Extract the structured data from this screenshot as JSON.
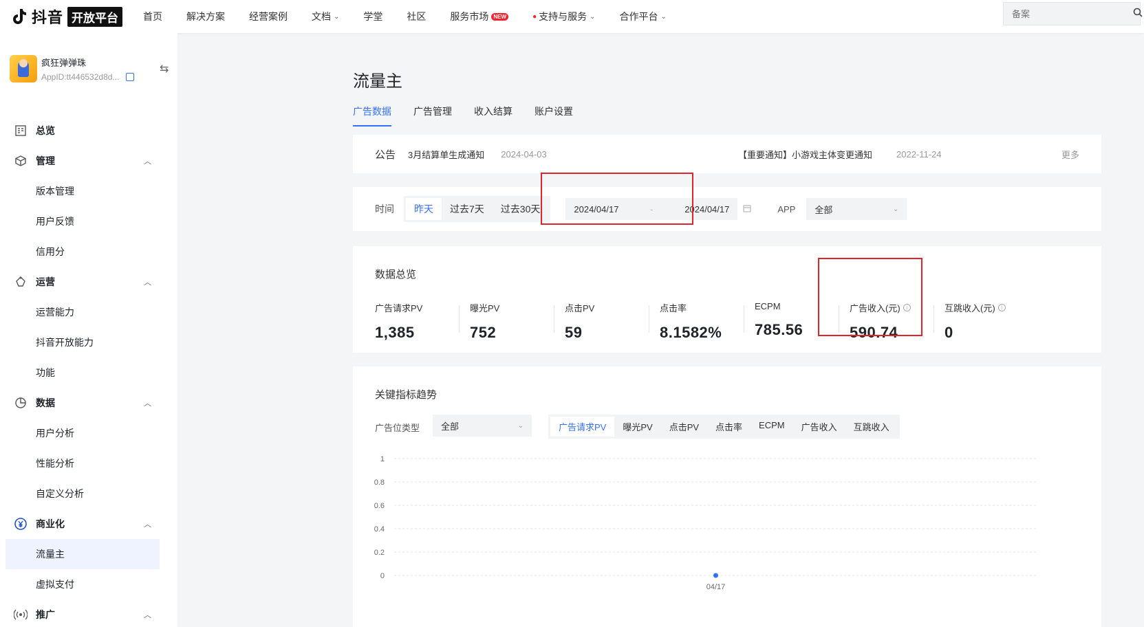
{
  "topnav": {
    "brand": "抖音",
    "badge": "开放平台",
    "links": [
      {
        "label": "首页",
        "dropdown": false
      },
      {
        "label": "解决方案",
        "dropdown": false
      },
      {
        "label": "经营案例",
        "dropdown": false
      },
      {
        "label": "文档",
        "dropdown": true
      },
      {
        "label": "学堂",
        "dropdown": false
      },
      {
        "label": "社区",
        "dropdown": false
      },
      {
        "label": "服务市场",
        "dropdown": false,
        "badge": "NEW"
      },
      {
        "label": "支持与服务",
        "dropdown": true,
        "hot": true
      },
      {
        "label": "合作平台",
        "dropdown": true
      }
    ],
    "search_placeholder": "备案"
  },
  "app": {
    "name": "疯狂弹弹珠",
    "appid": "AppID:tt446532d8d..."
  },
  "sidebar": {
    "items": [
      {
        "label": "总览",
        "type": "group",
        "icon": "dashboard-icon",
        "expandable": false
      },
      {
        "label": "管理",
        "type": "group",
        "icon": "cube-icon",
        "expandable": true
      },
      {
        "label": "版本管理",
        "type": "sub"
      },
      {
        "label": "用户反馈",
        "type": "sub"
      },
      {
        "label": "信用分",
        "type": "sub"
      },
      {
        "label": "运营",
        "type": "group",
        "icon": "operation-icon",
        "expandable": true
      },
      {
        "label": "运营能力",
        "type": "sub"
      },
      {
        "label": "抖音开放能力",
        "type": "sub"
      },
      {
        "label": "功能",
        "type": "sub"
      },
      {
        "label": "数据",
        "type": "group",
        "icon": "pie-chart-icon",
        "expandable": true
      },
      {
        "label": "用户分析",
        "type": "sub"
      },
      {
        "label": "性能分析",
        "type": "sub"
      },
      {
        "label": "自定义分析",
        "type": "sub"
      },
      {
        "label": "商业化",
        "type": "group",
        "icon": "yuan-icon",
        "expandable": true
      },
      {
        "label": "流量主",
        "type": "sub",
        "active": true
      },
      {
        "label": "虚拟支付",
        "type": "sub"
      },
      {
        "label": "推广",
        "type": "group",
        "icon": "broadcast-icon",
        "expandable": true
      }
    ]
  },
  "page": {
    "title": "流量主",
    "tabs": [
      "广告数据",
      "广告管理",
      "收入结算",
      "账户设置"
    ],
    "active_tab": 0
  },
  "notice": {
    "label": "公告",
    "item1": "3月结算单生成通知",
    "date1": "2024-04-03",
    "item2": "【重要通知】小游戏主体变更通知",
    "date2": "2022-11-24",
    "more": "更多"
  },
  "filter": {
    "time_label": "时间",
    "presets": [
      "昨天",
      "过去7天",
      "过去30天"
    ],
    "active_preset": 0,
    "start_date": "2024/04/17",
    "range_sep": "-",
    "end_date": "2024/04/17",
    "app_label": "APP",
    "app_value": "全部"
  },
  "overview": {
    "title": "数据总览",
    "metrics": [
      {
        "label": "广告请求PV",
        "value": "1,385",
        "info": false
      },
      {
        "label": "曝光PV",
        "value": "752",
        "info": false
      },
      {
        "label": "点击PV",
        "value": "59",
        "info": false
      },
      {
        "label": "点击率",
        "value": "8.1582%",
        "info": false
      },
      {
        "label": "ECPM",
        "value": "785.56",
        "info": false
      },
      {
        "label": "广告收入(元)",
        "value": "590.74",
        "info": true
      },
      {
        "label": "互跳收入(元)",
        "value": "0",
        "info": true
      }
    ]
  },
  "trend": {
    "title": "关键指标趋势",
    "placement_label": "广告位类型",
    "placement_value": "全部",
    "metric_tabs": [
      "广告请求PV",
      "曝光PV",
      "点击PV",
      "点击率",
      "ECPM",
      "广告收入",
      "互跳收入"
    ],
    "active_metric": 0
  },
  "colors": {
    "accent": "#3370ff",
    "highlight_box": "#e0242b"
  },
  "chart_data": {
    "type": "line",
    "x": [
      "04/17"
    ],
    "series": [
      {
        "values": [
          0
        ]
      }
    ],
    "ylim": [
      0,
      1
    ],
    "yticks": [
      "0",
      "0.2",
      "0.4",
      "0.6",
      "0.8",
      "1"
    ],
    "grid": true
  }
}
